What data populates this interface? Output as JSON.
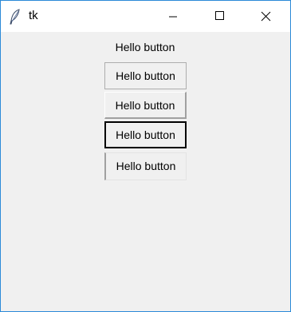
{
  "window": {
    "title": "tk",
    "controls": {
      "minimize": "minimize-icon",
      "maximize": "maximize-icon",
      "close": "close-icon"
    }
  },
  "content": {
    "label_text": "Hello button",
    "buttons": [
      {
        "label": "Hello button",
        "relief": "solid"
      },
      {
        "label": "Hello button",
        "relief": "raised"
      },
      {
        "label": "Hello button",
        "relief": "focused"
      },
      {
        "label": "Hello button",
        "relief": "sunken"
      }
    ]
  },
  "colors": {
    "window_border": "#2b8ad8",
    "background": "#f0f0f0",
    "titlebar": "#ffffff"
  }
}
